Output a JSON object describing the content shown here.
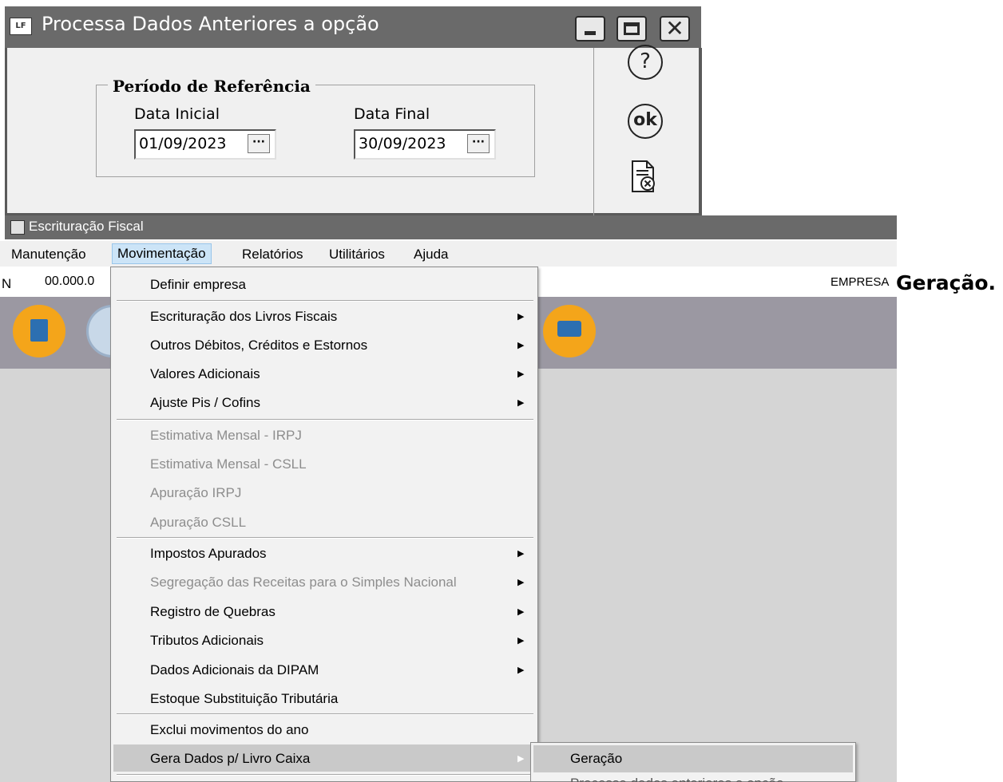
{
  "dialog": {
    "app_icon": "LF",
    "title": "Processa Dados Anteriores a opção",
    "group_title": "Período de Referência",
    "start_label": "Data Inicial",
    "start_value": "01/09/2023",
    "end_label": "Data Final",
    "end_value": "30/09/2023",
    "ellipsis": "···",
    "help_glyph": "?",
    "ok_label": "ok"
  },
  "main": {
    "title": "Escrituração Fiscal",
    "menubar": [
      "Manutenção",
      "Movimentação",
      "Relatórios",
      "Utilitários",
      "Ajuda"
    ],
    "active_menu": "Movimentação",
    "info": {
      "prefix": "N",
      "cnpj": "00.000.0",
      "empresa": "EMPRESA"
    }
  },
  "overlay_text": "Geração.",
  "dropdown": {
    "items": [
      {
        "label": "Definir empresa",
        "disabled": false,
        "submenu": false
      },
      {
        "label": "Escrituração dos Livros Fiscais",
        "disabled": false,
        "submenu": true
      },
      {
        "label": "Outros Débitos, Créditos e Estornos",
        "disabled": false,
        "submenu": true
      },
      {
        "label": "Valores Adicionais",
        "disabled": false,
        "submenu": true
      },
      {
        "label": "Ajuste Pis / Cofins",
        "disabled": false,
        "submenu": true
      },
      {
        "label": "Estimativa Mensal - IRPJ",
        "disabled": true,
        "submenu": false
      },
      {
        "label": "Estimativa Mensal - CSLL",
        "disabled": true,
        "submenu": false
      },
      {
        "label": "Apuração IRPJ",
        "disabled": true,
        "submenu": false
      },
      {
        "label": "Apuração CSLL",
        "disabled": true,
        "submenu": false
      },
      {
        "label": "Impostos Apurados",
        "disabled": false,
        "submenu": true
      },
      {
        "label": "Segregação das Receitas para o Simples Nacional",
        "disabled": true,
        "submenu": true
      },
      {
        "label": "Registro de Quebras",
        "disabled": false,
        "submenu": true
      },
      {
        "label": "Tributos Adicionais",
        "disabled": false,
        "submenu": true
      },
      {
        "label": "Dados Adicionais da DIPAM",
        "disabled": false,
        "submenu": true
      },
      {
        "label": "Estoque Substituição Tributária",
        "disabled": false,
        "submenu": false
      },
      {
        "label": "Exclui movimentos do ano",
        "disabled": false,
        "submenu": false
      },
      {
        "label": "Gera Dados p/ Livro Caixa",
        "disabled": false,
        "submenu": true,
        "highlighted": true
      }
    ]
  },
  "submenu": {
    "items": [
      {
        "label": "Geração",
        "highlighted": true
      },
      {
        "label": "Processa dados anteriores a opção",
        "partially_visible": true
      }
    ]
  },
  "colors": {
    "titlebar": "#6a6a6a",
    "toolbar": "#9b98a2",
    "workarea": "#d5d5d5",
    "menu_bg": "#f2f2f2",
    "menu_highlight": "#c9c9c9",
    "active_menu": "#cce4f7",
    "icon_orange": "#f4a51a",
    "icon_blue": "#2c6fb1"
  },
  "icons": [
    "help-icon",
    "ok-icon",
    "cancel-document-icon",
    "building-icon",
    "contributor-icon",
    "chat-help-icon"
  ]
}
